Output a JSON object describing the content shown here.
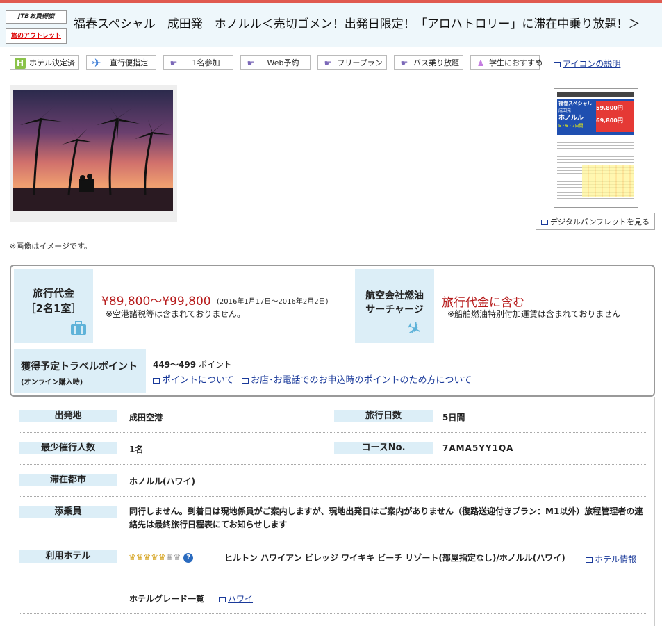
{
  "header": {
    "brand_top": "JTBお買得旅",
    "brand_bottom": "旅のアウトレット",
    "title": "福春スペシャル　成田発　ホノルル＜売切ゴメン！出発日限定！「アロハトロリー」に滞在中乗り放題！＞"
  },
  "feature_icons": [
    {
      "label": "ホテル決定済",
      "icon": "hotel-icon"
    },
    {
      "label": "直行便指定",
      "icon": "airplane-icon"
    },
    {
      "label": "1名参加",
      "icon": "pointer-hand-icon"
    },
    {
      "label": "Web予約",
      "icon": "pointer-hand-icon"
    },
    {
      "label": "フリープラン",
      "icon": "pointer-hand-icon"
    },
    {
      "label": "バス乗り放題",
      "icon": "pointer-hand-icon"
    },
    {
      "label": "学生におすすめ",
      "icon": "person-icon"
    }
  ],
  "icon_help_link": "アイコンの説明",
  "brochure": {
    "button_label": "デジタルパンフレットを見る",
    "thumb_title_1": "福春スペシャル",
    "thumb_title_2": "成田発",
    "thumb_title_3": "ホノルル",
    "thumb_days": "5・6・7日間",
    "thumb_price_1": "59,800円",
    "thumb_price_2": "69,800円"
  },
  "image_note": "※画像はイメージです。",
  "pricing": {
    "fare_label_1": "旅行代金",
    "fare_label_2": "［2名1室］",
    "fare_price": "¥89,800〜¥99,800",
    "fare_period": "(2016年1月17日〜2016年2月2日)",
    "fare_note": "※空港諸税等は含まれておりません。",
    "fuel_label_1": "航空会社燃油",
    "fuel_label_2": "サーチャージ",
    "fuel_value": "旅行代金に含む",
    "fuel_note": "※船舶燃油特別付加運賃は含まれておりません",
    "points_label": "獲得予定トラベルポイント",
    "points_sublabel": "(オンライン購入時)",
    "points_value": "449〜499",
    "points_unit": "ポイント",
    "points_link_1": "ポイントについて",
    "points_link_2": "お店･お電話でのお申込時のポイントのため方について"
  },
  "details": {
    "departure_label": "出発地",
    "departure_value": "成田空港",
    "days_label": "旅行日数",
    "days_value": "5日間",
    "min_people_label": "最少催行人数",
    "min_people_value": "1名",
    "course_label": "コースNo.",
    "course_value": "7AMA5YY1QA",
    "city_label": "滞在都市",
    "city_value": "ホノルル(ハワイ)",
    "guide_label": "添乗員",
    "guide_value": "同行しません。到着日は現地係員がご案内しますが、現地出発日はご案内がありません（復路送迎付きプラン：M1以外）旅程管理者の連絡先は最終旅行日程表にてお知らせします",
    "hotel_label": "利用ホテル",
    "hotel_crowns": "♛♛♛♛♛",
    "hotel_crowns_grey": "♛♛",
    "hotel_name": "ヒルトン ハワイアン ビレッジ ワイキキ ビーチ リゾート(部屋指定なし)/ホノルル(ハワイ)",
    "hotel_info_link": "ホテル情報",
    "hotel_grade_label": "ホテルグレード一覧",
    "hotel_grade_link": "ハワイ"
  }
}
